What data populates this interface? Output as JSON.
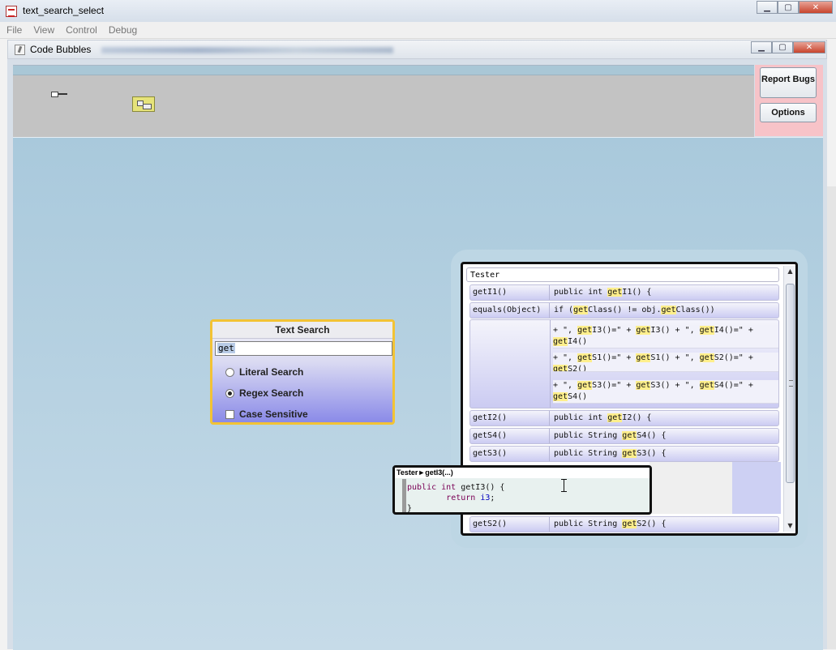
{
  "window": {
    "title": "text_search_select",
    "controls": {
      "minimize": "▁",
      "maximize": "▢",
      "close": "✕"
    }
  },
  "menu": [
    "File",
    "View",
    "Control",
    "Debug"
  ],
  "inner_window": {
    "title": "Code Bubbles"
  },
  "side_panel": {
    "report_bugs": "Report Bugs",
    "options": "Options"
  },
  "search_bubble": {
    "title": "Text Search",
    "query": "get",
    "options": {
      "literal": "Literal Search",
      "regex": "Regex Search",
      "case": "Case Sensitive"
    },
    "selected": "regex",
    "case_sensitive": false
  },
  "code_bubble": {
    "class_name": "Tester",
    "rows": [
      {
        "name": "getI1()",
        "code": "public int getI1() {"
      },
      {
        "name": "equals(Object)",
        "code": "if (getClass() != obj.getClass())"
      },
      {
        "name": "getI2()",
        "code": "public int getI2() {"
      },
      {
        "name": "getS4()",
        "code": "public String getS4() {"
      },
      {
        "name": "getS3()",
        "code": "public String getS3() {"
      },
      {
        "name": "getS2()",
        "code": "public String getS2() {"
      }
    ],
    "multi_lines": [
      "+ \", getI3()=\" + getI3() + \", getI4()=\" +",
      "getI4()",
      "+ \", getS1()=\" + getS1() + \", getS2()=\" +",
      "getS2()",
      "+ \", getS3()=\" + getS3() + \", getS4()=\" +",
      "getS4()"
    ]
  },
  "peek_bubble": {
    "title": "Tester►getI3(...)",
    "lines": [
      "public int getI3() {",
      "        return i3;",
      "}"
    ]
  },
  "colors": {
    "highlight": "#ffef8c",
    "bubble_border": "#f2c335",
    "canvas": "#a9c9dc"
  }
}
